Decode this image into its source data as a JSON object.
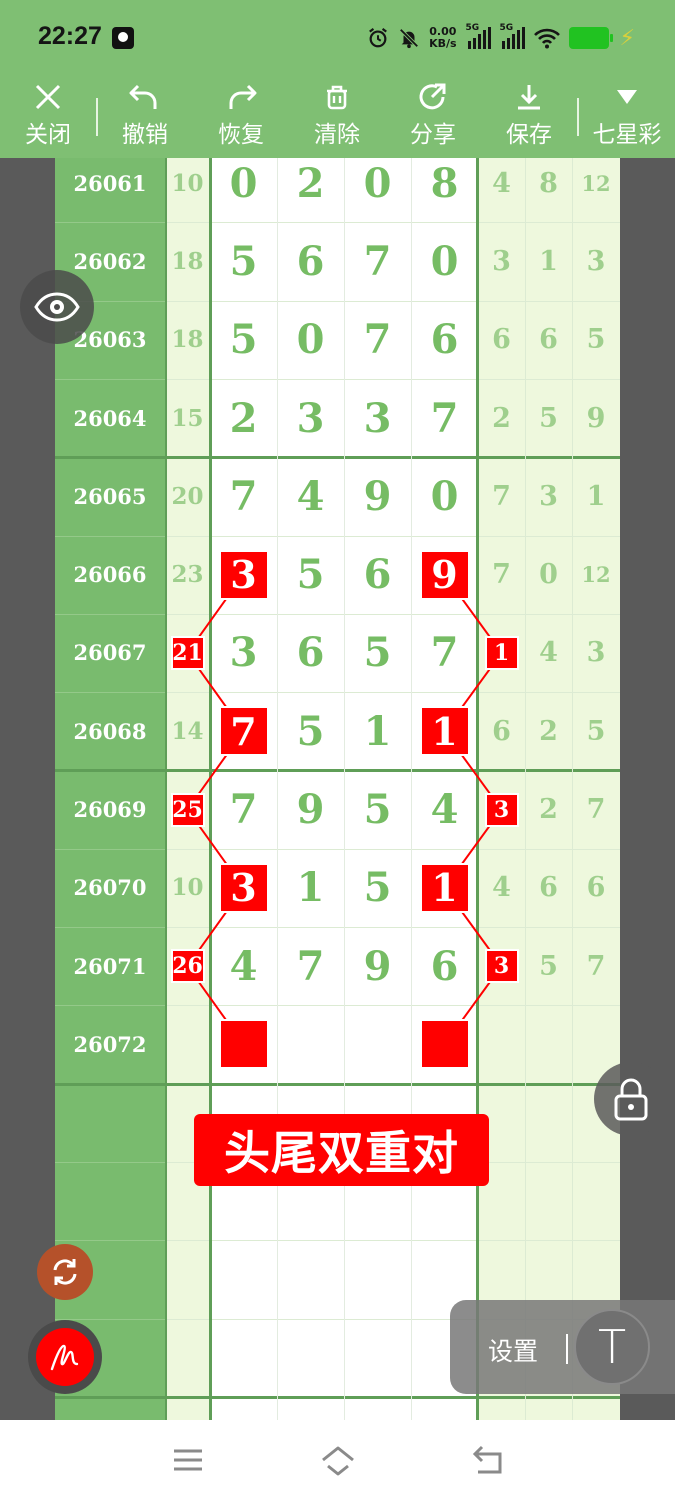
{
  "status_bar": {
    "time": "22:27",
    "net_speed_value": "0.00",
    "net_speed_unit": "KB/s",
    "sim1_label": "5G",
    "sim2_label": "5G",
    "battery_color": "#21c221"
  },
  "toolbar": {
    "buttons": [
      {
        "label": "关闭",
        "icon": "close-icon"
      },
      {
        "label": "撤销",
        "icon": "undo-icon"
      },
      {
        "label": "恢复",
        "icon": "redo-icon"
      },
      {
        "label": "清除",
        "icon": "trash-icon"
      },
      {
        "label": "分享",
        "icon": "share-icon"
      },
      {
        "label": "保存",
        "icon": "download-icon"
      },
      {
        "label": "七星彩",
        "icon": "triangle-down-icon"
      }
    ]
  },
  "table": {
    "rows": [
      {
        "period": "26061",
        "sum": "10",
        "digits": [
          "0",
          "2",
          "0",
          "8"
        ],
        "extra": [
          "4",
          "8",
          "12"
        ]
      },
      {
        "period": "26062",
        "sum": "18",
        "digits": [
          "5",
          "6",
          "7",
          "0"
        ],
        "extra": [
          "3",
          "1",
          "3"
        ]
      },
      {
        "period": "26063",
        "sum": "18",
        "digits": [
          "5",
          "0",
          "7",
          "6"
        ],
        "extra": [
          "6",
          "6",
          "5"
        ]
      },
      {
        "period": "26064",
        "sum": "15",
        "digits": [
          "2",
          "3",
          "3",
          "7"
        ],
        "extra": [
          "2",
          "5",
          "9"
        ]
      },
      {
        "period": "26065",
        "sum": "20",
        "digits": [
          "7",
          "4",
          "9",
          "0"
        ],
        "extra": [
          "7",
          "3",
          "1"
        ]
      },
      {
        "period": "26066",
        "sum": "23",
        "digits": [
          "3",
          "5",
          "6",
          "9"
        ],
        "extra": [
          "7",
          "0",
          "12"
        ]
      },
      {
        "period": "26067",
        "sum": "21",
        "digits": [
          "3",
          "6",
          "5",
          "7"
        ],
        "extra": [
          "1",
          "4",
          "3"
        ]
      },
      {
        "period": "26068",
        "sum": "14",
        "digits": [
          "7",
          "5",
          "1",
          "1"
        ],
        "extra": [
          "6",
          "2",
          "5"
        ]
      },
      {
        "period": "26069",
        "sum": "25",
        "digits": [
          "7",
          "9",
          "5",
          "4"
        ],
        "extra": [
          "3",
          "2",
          "7"
        ]
      },
      {
        "period": "26070",
        "sum": "10",
        "digits": [
          "3",
          "1",
          "5",
          "1"
        ],
        "extra": [
          "4",
          "6",
          "6"
        ]
      },
      {
        "period": "26071",
        "sum": "26",
        "digits": [
          "4",
          "7",
          "9",
          "6"
        ],
        "extra": [
          "3",
          "5",
          "7"
        ]
      },
      {
        "period": "26072",
        "sum": "",
        "digits": [
          "",
          "",
          "",
          ""
        ],
        "extra": [
          "",
          "",
          ""
        ]
      }
    ],
    "highlights": [
      {
        "row": 5,
        "col": "d0",
        "text": "3"
      },
      {
        "row": 5,
        "col": "d3",
        "text": "9"
      },
      {
        "row": 6,
        "col": "sum",
        "text": "21"
      },
      {
        "row": 6,
        "col": "e0",
        "text": "1"
      },
      {
        "row": 7,
        "col": "d0",
        "text": "7"
      },
      {
        "row": 7,
        "col": "d3",
        "text": "1"
      },
      {
        "row": 8,
        "col": "sum",
        "text": "25"
      },
      {
        "row": 8,
        "col": "e0",
        "text": "3"
      },
      {
        "row": 9,
        "col": "d0",
        "text": "3"
      },
      {
        "row": 9,
        "col": "d3",
        "text": "1"
      },
      {
        "row": 10,
        "col": "sum",
        "text": "26"
      },
      {
        "row": 10,
        "col": "e0",
        "text": "3"
      },
      {
        "row": 11,
        "col": "d0",
        "text": ""
      },
      {
        "row": 11,
        "col": "d3",
        "text": ""
      }
    ],
    "colors": {
      "period_bg": "#79bb6e",
      "side_bg": "#eef8dd",
      "main_digit": "#76bc64",
      "side_digit": "#9fcf8d",
      "highlight": "#ff0000"
    }
  },
  "pattern_label": "头尾双重对",
  "floating": {
    "eye": "eye-icon",
    "lock": "lock-icon",
    "rotate": "rotate-icon",
    "pen": "pen-icon",
    "settings_label": "设置",
    "text_tool_glyph": "T"
  },
  "nav": {
    "menu": "menu-icon",
    "home": "home-icon",
    "back": "back-icon"
  }
}
